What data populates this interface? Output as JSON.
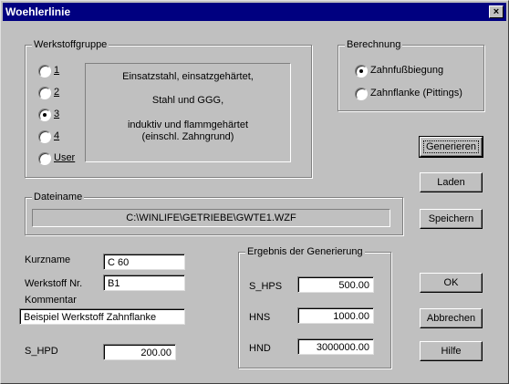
{
  "window": {
    "title": "Woehlerlinie",
    "close_glyph": "×"
  },
  "werkstoffgruppe": {
    "legend": "Werkstoffgruppe",
    "options": [
      {
        "label": "1",
        "selected": false
      },
      {
        "label": "2",
        "selected": false
      },
      {
        "label": "3",
        "selected": true
      },
      {
        "label": "4",
        "selected": false
      },
      {
        "label": "User",
        "selected": false
      }
    ],
    "info_lines": [
      "Einsatzstahl, einsatzgehärtet,",
      "Stahl und GGG,",
      "induktiv und flammgehärtet",
      "(einschl. Zahngrund)"
    ]
  },
  "berechnung": {
    "legend": "Berechnung",
    "options": [
      {
        "label": "Zahnfußbiegung",
        "selected": true
      },
      {
        "label": "Zahnflanke (Pittings)",
        "selected": false
      }
    ]
  },
  "dateiname": {
    "legend": "Dateiname",
    "value": "C:\\WINLIFE\\GETRIEBE\\GWTE1.WZF"
  },
  "fields": {
    "kurzname_label": "Kurzname",
    "kurzname_value": "C 60",
    "werkstoff_label": "Werkstoff Nr.",
    "werkstoff_value": "B1",
    "kommentar_label": "Kommentar",
    "kommentar_value": "Beispiel Werkstoff Zahnflanke",
    "shpd_label": "S_HPD",
    "shpd_value": "200.00"
  },
  "ergebnis": {
    "legend": "Ergebnis der Generierung",
    "shps_label": "S_HPS",
    "shps_value": "500.00",
    "hns_label": "HNS",
    "hns_value": "1000.00",
    "hnd_label": "HND",
    "hnd_value": "3000000.00"
  },
  "buttons": {
    "generieren": "Generieren",
    "laden": "Laden",
    "speichern": "Speichern",
    "ok": "OK",
    "abbrechen": "Abbrechen",
    "hilfe": "Hilfe"
  }
}
